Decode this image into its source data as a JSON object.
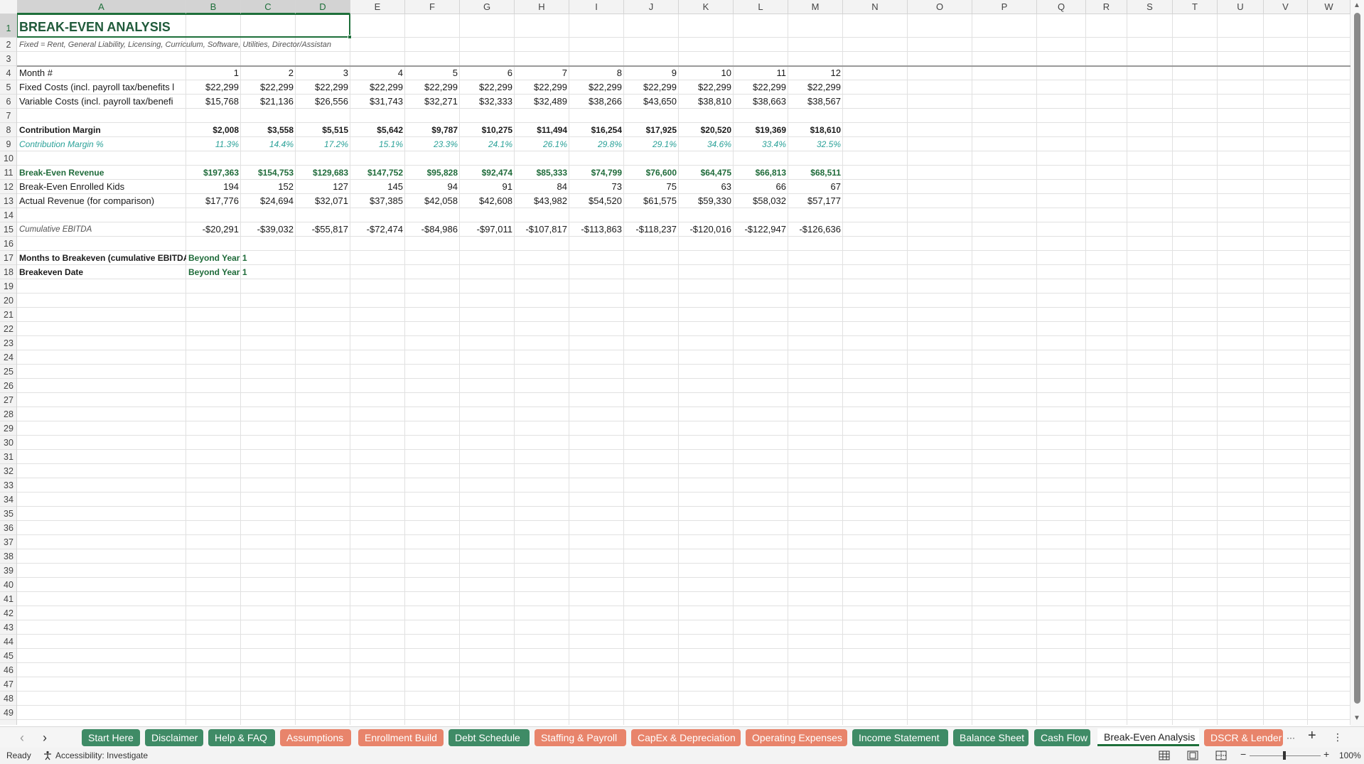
{
  "columns": [
    "A",
    "B",
    "C",
    "D",
    "E",
    "F",
    "G",
    "H",
    "I",
    "J",
    "K",
    "L",
    "M",
    "N",
    "O",
    "P",
    "Q",
    "R",
    "S",
    "T",
    "U",
    "V",
    "W"
  ],
  "selected_column_headers": [
    "A",
    "B",
    "C",
    "D"
  ],
  "rows": [
    {
      "n": "1",
      "cells": [
        {
          "col": 0,
          "text": "BREAK-EVEN ANALYSIS",
          "style": "title",
          "align": "l"
        }
      ]
    },
    {
      "n": "2",
      "cells": [
        {
          "col": 0,
          "text": "Fixed = Rent, General Liability, Licensing, Curriculum, Software, Utilities, Director/Assistan",
          "style": "note",
          "align": "l",
          "span": 4
        }
      ]
    },
    {
      "n": "3",
      "cells": []
    },
    {
      "n": "4",
      "cells": [
        {
          "col": 0,
          "text": "Month #",
          "style": "",
          "align": "l"
        },
        {
          "col": 1,
          "text": "1",
          "align": "r"
        },
        {
          "col": 2,
          "text": "2",
          "align": "r"
        },
        {
          "col": 3,
          "text": "3",
          "align": "r"
        },
        {
          "col": 4,
          "text": "4",
          "align": "r"
        },
        {
          "col": 5,
          "text": "5",
          "align": "r"
        },
        {
          "col": 6,
          "text": "6",
          "align": "r"
        },
        {
          "col": 7,
          "text": "7",
          "align": "r"
        },
        {
          "col": 8,
          "text": "8",
          "align": "r"
        },
        {
          "col": 9,
          "text": "9",
          "align": "r"
        },
        {
          "col": 10,
          "text": "10",
          "align": "r"
        },
        {
          "col": 11,
          "text": "11",
          "align": "r"
        },
        {
          "col": 12,
          "text": "12",
          "align": "r"
        }
      ]
    },
    {
      "n": "5",
      "cells": [
        {
          "col": 0,
          "text": "Fixed Costs (incl. payroll tax/benefits l",
          "align": "l"
        },
        {
          "col": 1,
          "text": "$22,299",
          "align": "r"
        },
        {
          "col": 2,
          "text": "$22,299",
          "align": "r"
        },
        {
          "col": 3,
          "text": "$22,299",
          "align": "r"
        },
        {
          "col": 4,
          "text": "$22,299",
          "align": "r"
        },
        {
          "col": 5,
          "text": "$22,299",
          "align": "r"
        },
        {
          "col": 6,
          "text": "$22,299",
          "align": "r"
        },
        {
          "col": 7,
          "text": "$22,299",
          "align": "r"
        },
        {
          "col": 8,
          "text": "$22,299",
          "align": "r"
        },
        {
          "col": 9,
          "text": "$22,299",
          "align": "r"
        },
        {
          "col": 10,
          "text": "$22,299",
          "align": "r"
        },
        {
          "col": 11,
          "text": "$22,299",
          "align": "r"
        },
        {
          "col": 12,
          "text": "$22,299",
          "align": "r"
        }
      ]
    },
    {
      "n": "6",
      "cells": [
        {
          "col": 0,
          "text": "Variable Costs (incl. payroll tax/benefi",
          "align": "l"
        },
        {
          "col": 1,
          "text": "$15,768",
          "align": "r"
        },
        {
          "col": 2,
          "text": "$21,136",
          "align": "r"
        },
        {
          "col": 3,
          "text": "$26,556",
          "align": "r"
        },
        {
          "col": 4,
          "text": "$31,743",
          "align": "r"
        },
        {
          "col": 5,
          "text": "$32,271",
          "align": "r"
        },
        {
          "col": 6,
          "text": "$32,333",
          "align": "r"
        },
        {
          "col": 7,
          "text": "$32,489",
          "align": "r"
        },
        {
          "col": 8,
          "text": "$38,266",
          "align": "r"
        },
        {
          "col": 9,
          "text": "$43,650",
          "align": "r"
        },
        {
          "col": 10,
          "text": "$38,810",
          "align": "r"
        },
        {
          "col": 11,
          "text": "$38,663",
          "align": "r"
        },
        {
          "col": 12,
          "text": "$38,567",
          "align": "r"
        }
      ]
    },
    {
      "n": "7",
      "cells": []
    },
    {
      "n": "8",
      "cells": [
        {
          "col": 0,
          "text": "Contribution Margin",
          "style": "bold",
          "align": "l"
        },
        {
          "col": 1,
          "text": "$2,008",
          "style": "bold",
          "align": "r"
        },
        {
          "col": 2,
          "text": "$3,558",
          "style": "bold",
          "align": "r"
        },
        {
          "col": 3,
          "text": "$5,515",
          "style": "bold",
          "align": "r"
        },
        {
          "col": 4,
          "text": "$5,642",
          "style": "bold",
          "align": "r"
        },
        {
          "col": 5,
          "text": "$9,787",
          "style": "bold",
          "align": "r"
        },
        {
          "col": 6,
          "text": "$10,275",
          "style": "bold",
          "align": "r"
        },
        {
          "col": 7,
          "text": "$11,494",
          "style": "bold",
          "align": "r"
        },
        {
          "col": 8,
          "text": "$16,254",
          "style": "bold",
          "align": "r"
        },
        {
          "col": 9,
          "text": "$17,925",
          "style": "bold",
          "align": "r"
        },
        {
          "col": 10,
          "text": "$20,520",
          "style": "bold",
          "align": "r"
        },
        {
          "col": 11,
          "text": "$19,369",
          "style": "bold",
          "align": "r"
        },
        {
          "col": 12,
          "text": "$18,610",
          "style": "bold",
          "align": "r"
        }
      ]
    },
    {
      "n": "9",
      "cells": [
        {
          "col": 0,
          "text": "Contribution Margin %",
          "style": "teal-i",
          "align": "l"
        },
        {
          "col": 1,
          "text": "11.3%",
          "style": "teal-i",
          "align": "r"
        },
        {
          "col": 2,
          "text": "14.4%",
          "style": "teal-i",
          "align": "r"
        },
        {
          "col": 3,
          "text": "17.2%",
          "style": "teal-i",
          "align": "r"
        },
        {
          "col": 4,
          "text": "15.1%",
          "style": "teal-i",
          "align": "r"
        },
        {
          "col": 5,
          "text": "23.3%",
          "style": "teal-i",
          "align": "r"
        },
        {
          "col": 6,
          "text": "24.1%",
          "style": "teal-i",
          "align": "r"
        },
        {
          "col": 7,
          "text": "26.1%",
          "style": "teal-i",
          "align": "r"
        },
        {
          "col": 8,
          "text": "29.8%",
          "style": "teal-i",
          "align": "r"
        },
        {
          "col": 9,
          "text": "29.1%",
          "style": "teal-i",
          "align": "r"
        },
        {
          "col": 10,
          "text": "34.6%",
          "style": "teal-i",
          "align": "r"
        },
        {
          "col": 11,
          "text": "33.4%",
          "style": "teal-i",
          "align": "r"
        },
        {
          "col": 12,
          "text": "32.5%",
          "style": "teal-i",
          "align": "r"
        }
      ]
    },
    {
      "n": "10",
      "cells": []
    },
    {
      "n": "11",
      "cells": [
        {
          "col": 0,
          "text": "Break-Even Revenue",
          "style": "green-b",
          "align": "l"
        },
        {
          "col": 1,
          "text": "$197,363",
          "style": "green-b",
          "align": "r"
        },
        {
          "col": 2,
          "text": "$154,753",
          "style": "green-b",
          "align": "r"
        },
        {
          "col": 3,
          "text": "$129,683",
          "style": "green-b",
          "align": "r"
        },
        {
          "col": 4,
          "text": "$147,752",
          "style": "green-b",
          "align": "r"
        },
        {
          "col": 5,
          "text": "$95,828",
          "style": "green-b",
          "align": "r"
        },
        {
          "col": 6,
          "text": "$92,474",
          "style": "green-b",
          "align": "r"
        },
        {
          "col": 7,
          "text": "$85,333",
          "style": "green-b",
          "align": "r"
        },
        {
          "col": 8,
          "text": "$74,799",
          "style": "green-b",
          "align": "r"
        },
        {
          "col": 9,
          "text": "$76,600",
          "style": "green-b",
          "align": "r"
        },
        {
          "col": 10,
          "text": "$64,475",
          "style": "green-b",
          "align": "r"
        },
        {
          "col": 11,
          "text": "$66,813",
          "style": "green-b",
          "align": "r"
        },
        {
          "col": 12,
          "text": "$68,511",
          "style": "green-b",
          "align": "r"
        }
      ]
    },
    {
      "n": "12",
      "cells": [
        {
          "col": 0,
          "text": "Break-Even Enrolled Kids",
          "align": "l"
        },
        {
          "col": 1,
          "text": "194",
          "align": "r"
        },
        {
          "col": 2,
          "text": "152",
          "align": "r"
        },
        {
          "col": 3,
          "text": "127",
          "align": "r"
        },
        {
          "col": 4,
          "text": "145",
          "align": "r"
        },
        {
          "col": 5,
          "text": "94",
          "align": "r"
        },
        {
          "col": 6,
          "text": "91",
          "align": "r"
        },
        {
          "col": 7,
          "text": "84",
          "align": "r"
        },
        {
          "col": 8,
          "text": "73",
          "align": "r"
        },
        {
          "col": 9,
          "text": "75",
          "align": "r"
        },
        {
          "col": 10,
          "text": "63",
          "align": "r"
        },
        {
          "col": 11,
          "text": "66",
          "align": "r"
        },
        {
          "col": 12,
          "text": "67",
          "align": "r"
        }
      ]
    },
    {
      "n": "13",
      "cells": [
        {
          "col": 0,
          "text": "Actual Revenue (for comparison)",
          "align": "l"
        },
        {
          "col": 1,
          "text": "$17,776",
          "align": "r"
        },
        {
          "col": 2,
          "text": "$24,694",
          "align": "r"
        },
        {
          "col": 3,
          "text": "$32,071",
          "align": "r"
        },
        {
          "col": 4,
          "text": "$37,385",
          "align": "r"
        },
        {
          "col": 5,
          "text": "$42,058",
          "align": "r"
        },
        {
          "col": 6,
          "text": "$42,608",
          "align": "r"
        },
        {
          "col": 7,
          "text": "$43,982",
          "align": "r"
        },
        {
          "col": 8,
          "text": "$54,520",
          "align": "r"
        },
        {
          "col": 9,
          "text": "$61,575",
          "align": "r"
        },
        {
          "col": 10,
          "text": "$59,330",
          "align": "r"
        },
        {
          "col": 11,
          "text": "$58,032",
          "align": "r"
        },
        {
          "col": 12,
          "text": "$57,177",
          "align": "r"
        }
      ]
    },
    {
      "n": "14",
      "cells": []
    },
    {
      "n": "15",
      "cells": [
        {
          "col": 0,
          "text": "Cumulative EBITDA",
          "style": "gray-i",
          "align": "l"
        },
        {
          "col": 1,
          "text": "-$20,291",
          "align": "r"
        },
        {
          "col": 2,
          "text": "-$39,032",
          "align": "r"
        },
        {
          "col": 3,
          "text": "-$55,817",
          "align": "r"
        },
        {
          "col": 4,
          "text": "-$72,474",
          "align": "r"
        },
        {
          "col": 5,
          "text": "-$84,986",
          "align": "r"
        },
        {
          "col": 6,
          "text": "-$97,011",
          "align": "r"
        },
        {
          "col": 7,
          "text": "-$107,817",
          "align": "r"
        },
        {
          "col": 8,
          "text": "-$113,863",
          "align": "r"
        },
        {
          "col": 9,
          "text": "-$118,237",
          "align": "r"
        },
        {
          "col": 10,
          "text": "-$120,016",
          "align": "r"
        },
        {
          "col": 11,
          "text": "-$122,947",
          "align": "r"
        },
        {
          "col": 12,
          "text": "-$126,636",
          "align": "r"
        }
      ]
    },
    {
      "n": "16",
      "cells": []
    },
    {
      "n": "17",
      "cells": [
        {
          "col": 0,
          "text": "Months to Breakeven (cumulative EBITDA t",
          "style": "bold",
          "align": "l"
        },
        {
          "col": 1,
          "text": "Beyond Year 1",
          "style": "green-b",
          "align": "l",
          "span": 2
        }
      ]
    },
    {
      "n": "18",
      "cells": [
        {
          "col": 0,
          "text": "Breakeven Date",
          "style": "bold",
          "align": "l"
        },
        {
          "col": 1,
          "text": "Beyond Year 1",
          "style": "green-b",
          "align": "l",
          "span": 2
        }
      ]
    }
  ],
  "empty_row_numbers": [
    "19",
    "20",
    "21",
    "22",
    "23",
    "24",
    "25",
    "26",
    "27",
    "28",
    "29",
    "30",
    "31",
    "32",
    "33",
    "34",
    "35",
    "36",
    "37",
    "38",
    "39",
    "40",
    "41",
    "42",
    "43",
    "44",
    "45",
    "46",
    "47",
    "48",
    "49"
  ],
  "tabs": [
    {
      "label": "Start Here",
      "color": "#3f8b66"
    },
    {
      "label": "Disclaimer",
      "color": "#3f8b66"
    },
    {
      "label": "Help & FAQ",
      "color": "#3f8b66"
    },
    {
      "label": "Assumptions",
      "color": "#e8846b"
    },
    {
      "label": "Enrollment Build",
      "color": "#e8846b"
    },
    {
      "label": "Debt Schedule",
      "color": "#3f8b66"
    },
    {
      "label": "Staffing & Payroll",
      "color": "#e8846b"
    },
    {
      "label": "CapEx & Depreciation",
      "color": "#e8846b"
    },
    {
      "label": "Operating Expenses",
      "color": "#e8846b"
    },
    {
      "label": "Income Statement",
      "color": "#3f8b66"
    },
    {
      "label": "Balance Sheet",
      "color": "#3f8b66"
    },
    {
      "label": "Cash Flow",
      "color": "#3f8b66"
    },
    {
      "label": "Break-Even Analysis",
      "color": "active"
    },
    {
      "label": "DSCR & Lender",
      "color": "#e8846b"
    }
  ],
  "tabbar": {
    "prev_icon": "‹",
    "next_icon": "›",
    "more_icon": "···",
    "add_icon": "+",
    "menu_icon": "⋮"
  },
  "status": {
    "ready": "Ready",
    "accessibility": "Accessibility: Investigate",
    "zoom": "100%"
  },
  "selection": {
    "cell": "A1",
    "span_columns": 4
  },
  "colors": {
    "accent": "#1e6f3a",
    "tab_green": "#3f8b66",
    "tab_orange": "#e8846b"
  }
}
